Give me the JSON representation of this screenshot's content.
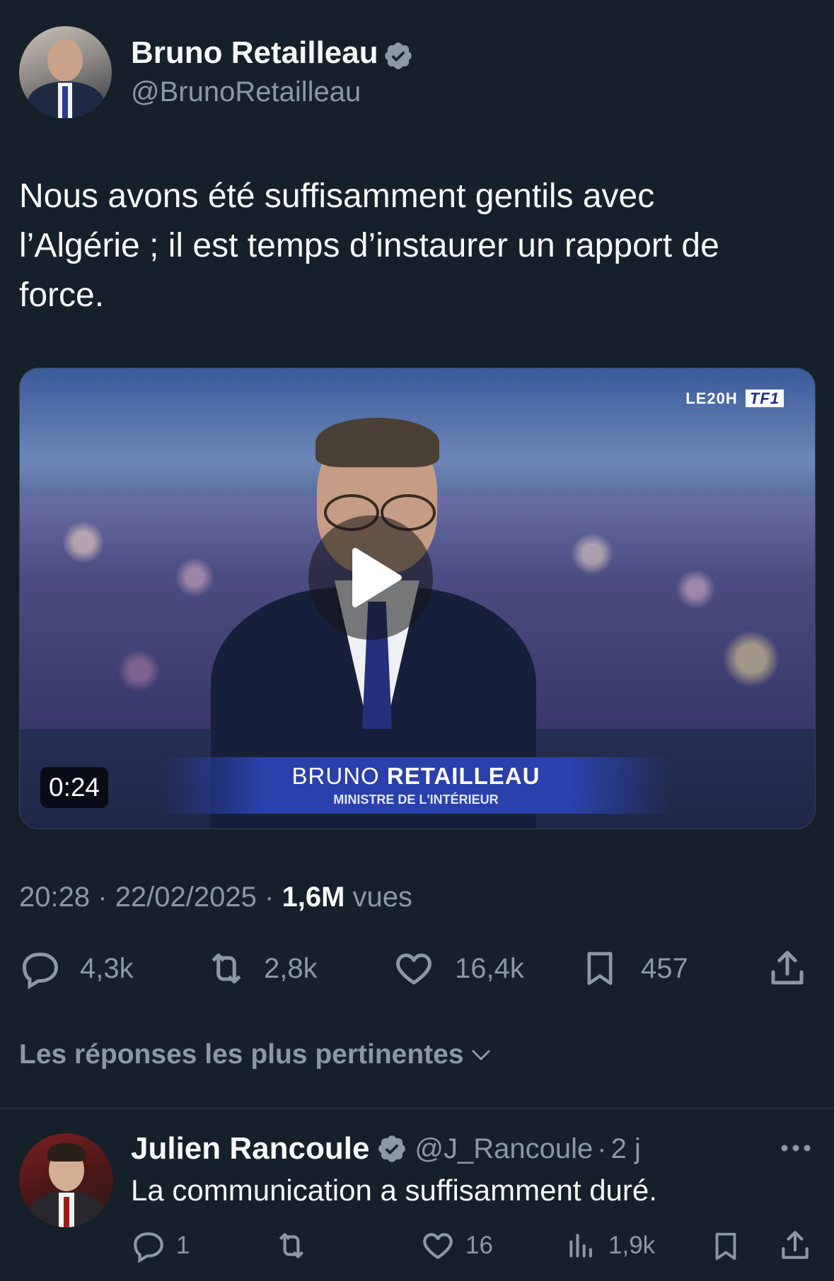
{
  "tweet": {
    "author_name": "Bruno Retailleau",
    "author_handle": "@BrunoRetailleau",
    "text_line1": "Nous avons été suffisamment gentils avec",
    "text_line2": "l’Algérie ; il est temps d’instaurer un rapport de",
    "text_line3": "force.",
    "video": {
      "duration": "0:24",
      "lower_third_name_first": "BRUNO",
      "lower_third_name_last": "RETAILLEAU",
      "lower_third_title": "MINISTRE DE L'INTÉRIEUR",
      "channel_logo_prefix": "LE20H",
      "channel_logo": "TF1"
    },
    "time": "20:28",
    "date": "22/02/2025",
    "views_value": "1,6M",
    "views_label": "vues",
    "separator": "·",
    "actions": {
      "replies": "4,3k",
      "reposts": "2,8k",
      "likes": "16,4k",
      "bookmarks": "457"
    }
  },
  "sort_label": "Les réponses les plus pertinentes",
  "reply": {
    "author_name": "Julien Rancoule",
    "author_handle": "@J_Rancoule",
    "separator": "·",
    "age": "2 j",
    "text": "La communication a suffisamment duré.",
    "actions": {
      "replies": "1",
      "likes": "16",
      "views": "1,9k"
    }
  },
  "colors": {
    "background": "#15202b",
    "text": "#f7f9f9",
    "muted": "#8b98a5",
    "verified": "#1d9bf0",
    "divider": "#38444d"
  },
  "icons": [
    "verified-icon",
    "play-icon",
    "reply-icon",
    "repost-icon",
    "like-icon",
    "bookmark-icon",
    "share-icon",
    "chevron-down-icon",
    "more-icon",
    "views-icon"
  ]
}
